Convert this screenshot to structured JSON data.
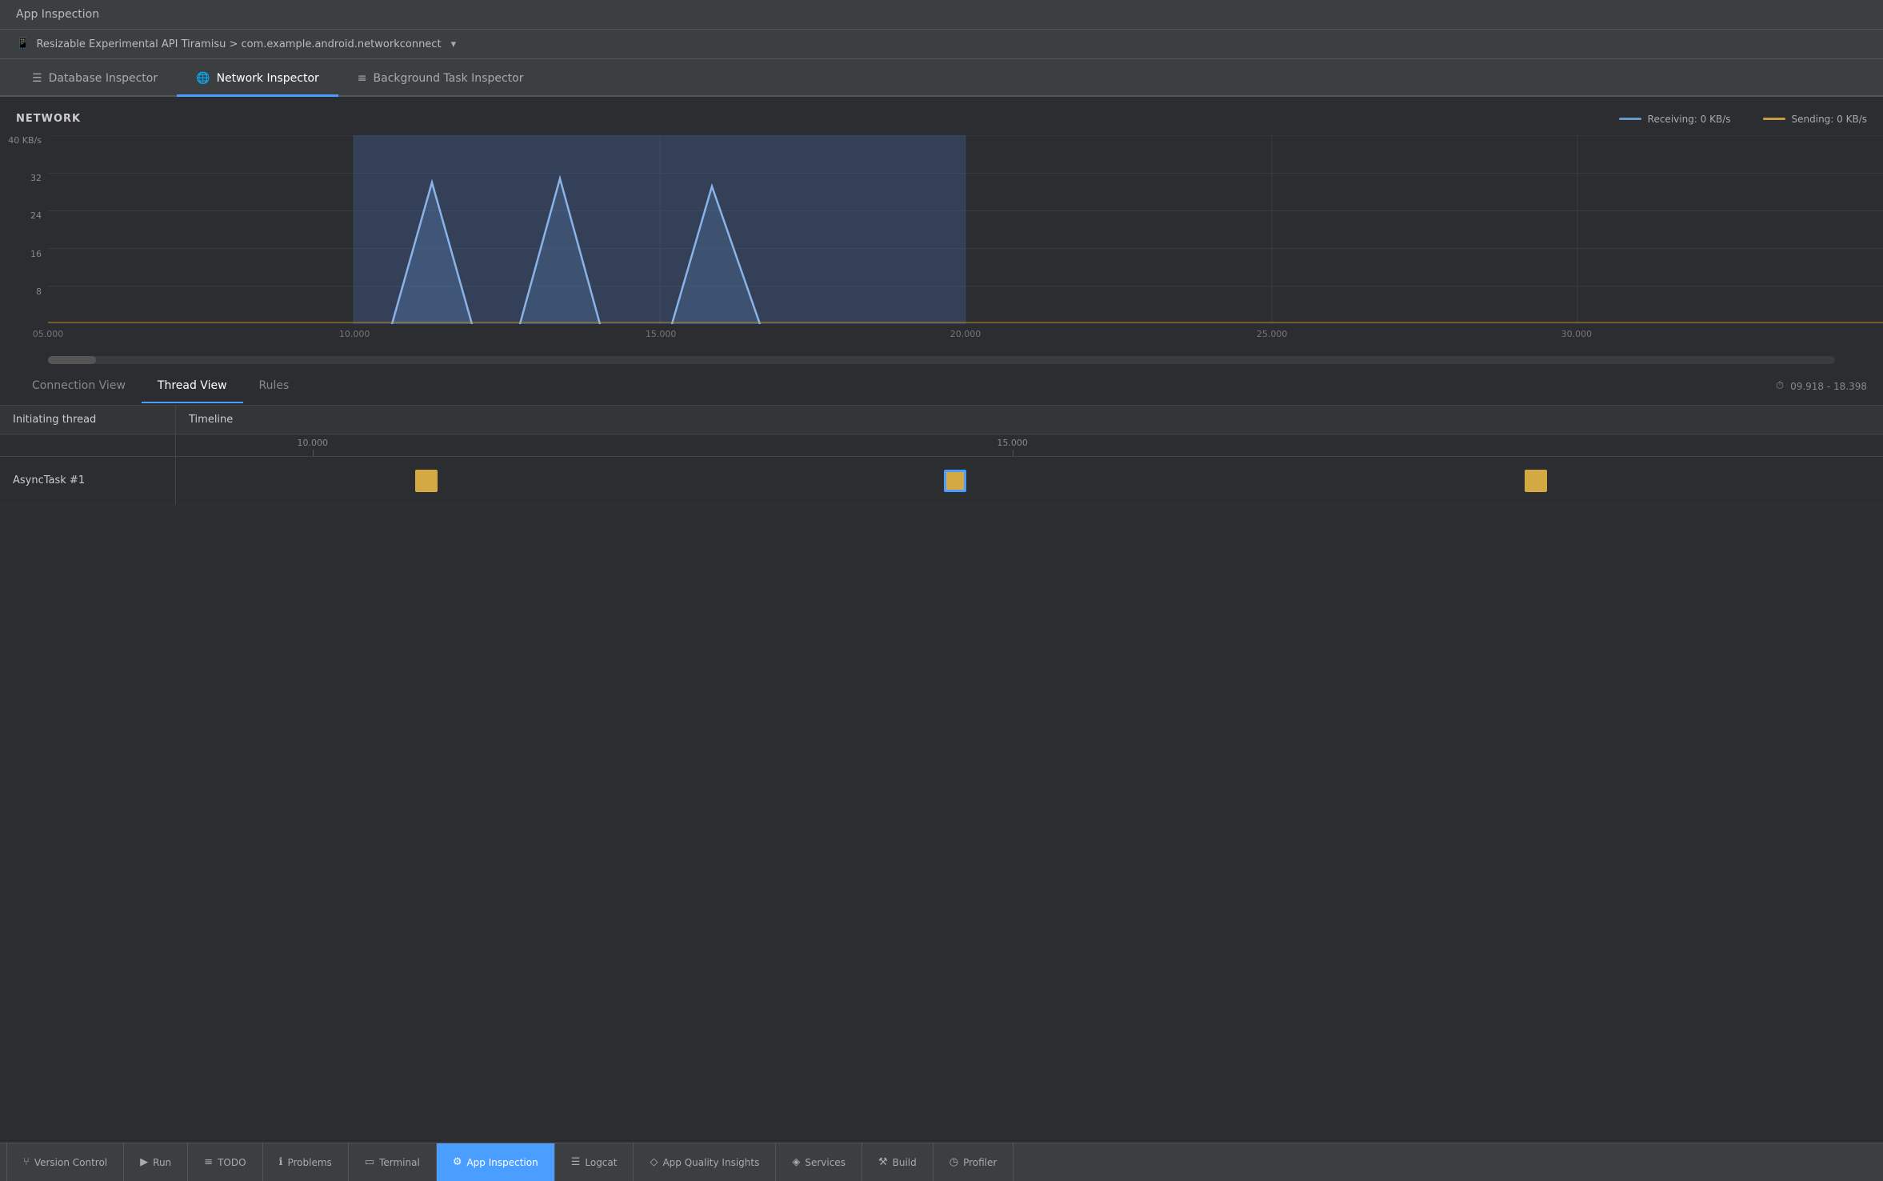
{
  "title_bar": {
    "label": "App Inspection"
  },
  "device_bar": {
    "icon": "📱",
    "name": "Resizable Experimental API Tiramisu > com.example.android.networkconnect",
    "chevron": "▾"
  },
  "inspector_tabs": [
    {
      "id": "database",
      "icon": "☰",
      "label": "Database Inspector",
      "active": false
    },
    {
      "id": "network",
      "icon": "🌐",
      "label": "Network Inspector",
      "active": true
    },
    {
      "id": "background",
      "icon": "≡",
      "label": "Background Task Inspector",
      "active": false
    }
  ],
  "chart": {
    "title": "NETWORK",
    "y_axis": {
      "max_label": "40 KB/s",
      "labels": [
        "32",
        "24",
        "16",
        "8"
      ]
    },
    "x_axis": {
      "labels": [
        "05.000",
        "10.000",
        "15.000",
        "20.000",
        "25.000",
        "30.000"
      ]
    },
    "legend": {
      "receiving": {
        "label": "Receiving: 0 KB/s"
      },
      "sending": {
        "label": "Sending: 0 KB/s"
      }
    }
  },
  "view_tabs": [
    {
      "id": "connection",
      "label": "Connection View",
      "active": false
    },
    {
      "id": "thread",
      "label": "Thread View",
      "active": true
    },
    {
      "id": "rules",
      "label": "Rules",
      "active": false
    }
  ],
  "time_range": {
    "icon": "⏱",
    "value": "09.918 - 18.398"
  },
  "thread_table": {
    "col_initiating": "Initiating thread",
    "col_timeline": "Timeline",
    "ruler_labels": [
      "10.000",
      "15.000"
    ],
    "rows": [
      {
        "name": "AsyncTask #1",
        "tasks": [
          {
            "pos_pct": 14,
            "selected": false
          },
          {
            "pos_pct": 45,
            "selected": true
          },
          {
            "pos_pct": 79,
            "selected": false
          }
        ]
      }
    ]
  },
  "status_bar": {
    "items": [
      {
        "id": "version-control",
        "icon": "⑂",
        "label": "Version Control",
        "active": false
      },
      {
        "id": "run",
        "icon": "▶",
        "label": "Run",
        "active": false
      },
      {
        "id": "todo",
        "icon": "≡",
        "label": "TODO",
        "active": false
      },
      {
        "id": "problems",
        "icon": "ℹ",
        "label": "Problems",
        "active": false
      },
      {
        "id": "terminal",
        "icon": "▭",
        "label": "Terminal",
        "active": false
      },
      {
        "id": "app-inspection",
        "icon": "⚙",
        "label": "App Inspection",
        "active": true
      },
      {
        "id": "logcat",
        "icon": "☰",
        "label": "Logcat",
        "active": false
      },
      {
        "id": "app-quality",
        "icon": "◇",
        "label": "App Quality Insights",
        "active": false
      },
      {
        "id": "services",
        "icon": "◈",
        "label": "Services",
        "active": false
      },
      {
        "id": "build",
        "icon": "⚒",
        "label": "Build",
        "active": false
      },
      {
        "id": "profiler",
        "icon": "◷",
        "label": "Profiler",
        "active": false
      }
    ]
  }
}
